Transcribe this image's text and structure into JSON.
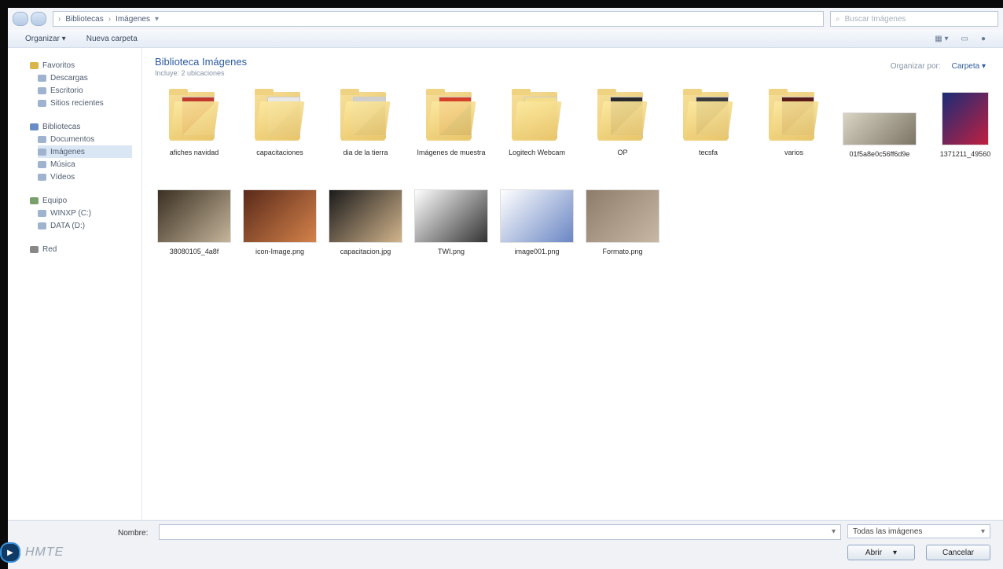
{
  "address": {
    "crumbs": [
      "Bibliotecas",
      "Imágenes"
    ],
    "search_placeholder": "Buscar Imágenes"
  },
  "toolbar": {
    "organize": "Organizar ▾",
    "new_folder": "Nueva carpeta"
  },
  "sidebar": {
    "groups": [
      {
        "label": "Favoritos",
        "items": [
          "Descargas",
          "Escritorio",
          "Sitios recientes"
        ]
      },
      {
        "label": "Bibliotecas",
        "items": [
          "Documentos",
          "Imágenes",
          "Música",
          "Vídeos"
        ]
      },
      {
        "label": "Equipo",
        "items": [
          "WINXP (C:)",
          "DATA (D:)"
        ]
      },
      {
        "label": "Red",
        "items": []
      }
    ],
    "selected": "Imágenes"
  },
  "content": {
    "title": "Biblioteca Imágenes",
    "subtitle": "Incluye: 2 ubicaciones",
    "arrange_label": "Organizar por:",
    "arrange_value": "Carpeta ▾"
  },
  "items_row1": [
    {
      "label": "afiches navidad",
      "kind": "folder",
      "art": [
        "#c0392b",
        "#ffffff"
      ]
    },
    {
      "label": "capacitaciones",
      "kind": "folder",
      "art": [
        "#e8e8e8",
        "#bdbdbd"
      ]
    },
    {
      "label": "dia de la tierra",
      "kind": "folder",
      "art": [
        "#cfcfcf",
        "#8a8a8a"
      ]
    },
    {
      "label": "Imágenes de muestra",
      "kind": "folder",
      "art": [
        "#d64027",
        "#2a1a14"
      ]
    },
    {
      "label": "Logitech Webcam",
      "kind": "folder",
      "art": [
        "#f4dd8a",
        "#ead08a"
      ]
    },
    {
      "label": "OP",
      "kind": "folder",
      "art": [
        "#2a2a2a",
        "#9a9a9a"
      ]
    },
    {
      "label": "tecsfa",
      "kind": "folder",
      "art": [
        "#3a3a3a",
        "#bdbdbd"
      ]
    },
    {
      "label": "varios",
      "kind": "folder",
      "art": [
        "#5a1a16",
        "#8a8a8a"
      ]
    },
    {
      "label": "01f5a8e0c56ff6d9e",
      "kind": "image",
      "art": [
        "#d9d4c3",
        "#7c7566"
      ]
    },
    {
      "label": "1371211_49560",
      "kind": "image",
      "art": [
        "#1a2c77",
        "#c02040"
      ]
    }
  ],
  "items_row2": [
    {
      "label": "38080105_4a8f",
      "kind": "image",
      "art": [
        "#3a2f22",
        "#c4b59a"
      ]
    },
    {
      "label": "icon-Image.png",
      "kind": "image",
      "art": [
        "#5a2a1a",
        "#d4824a"
      ]
    },
    {
      "label": "capacitacion.jpg",
      "kind": "image",
      "art": [
        "#1b1b1b",
        "#d2b48c"
      ]
    },
    {
      "label": "TWI.png",
      "kind": "image",
      "art": [
        "#ffffff",
        "#333333"
      ]
    },
    {
      "label": "image001.png",
      "kind": "image",
      "art": [
        "#ffffff",
        "#6a86c4"
      ]
    },
    {
      "label": "Formato.png",
      "kind": "image",
      "art": [
        "#8d7c6a",
        "#c7b8a4"
      ]
    }
  ],
  "bottom": {
    "filename_label": "Nombre:",
    "filetype": "Todas las imágenes",
    "open_label": "Abrir",
    "cancel_label": "Cancelar"
  },
  "logo_text": "HMTE"
}
